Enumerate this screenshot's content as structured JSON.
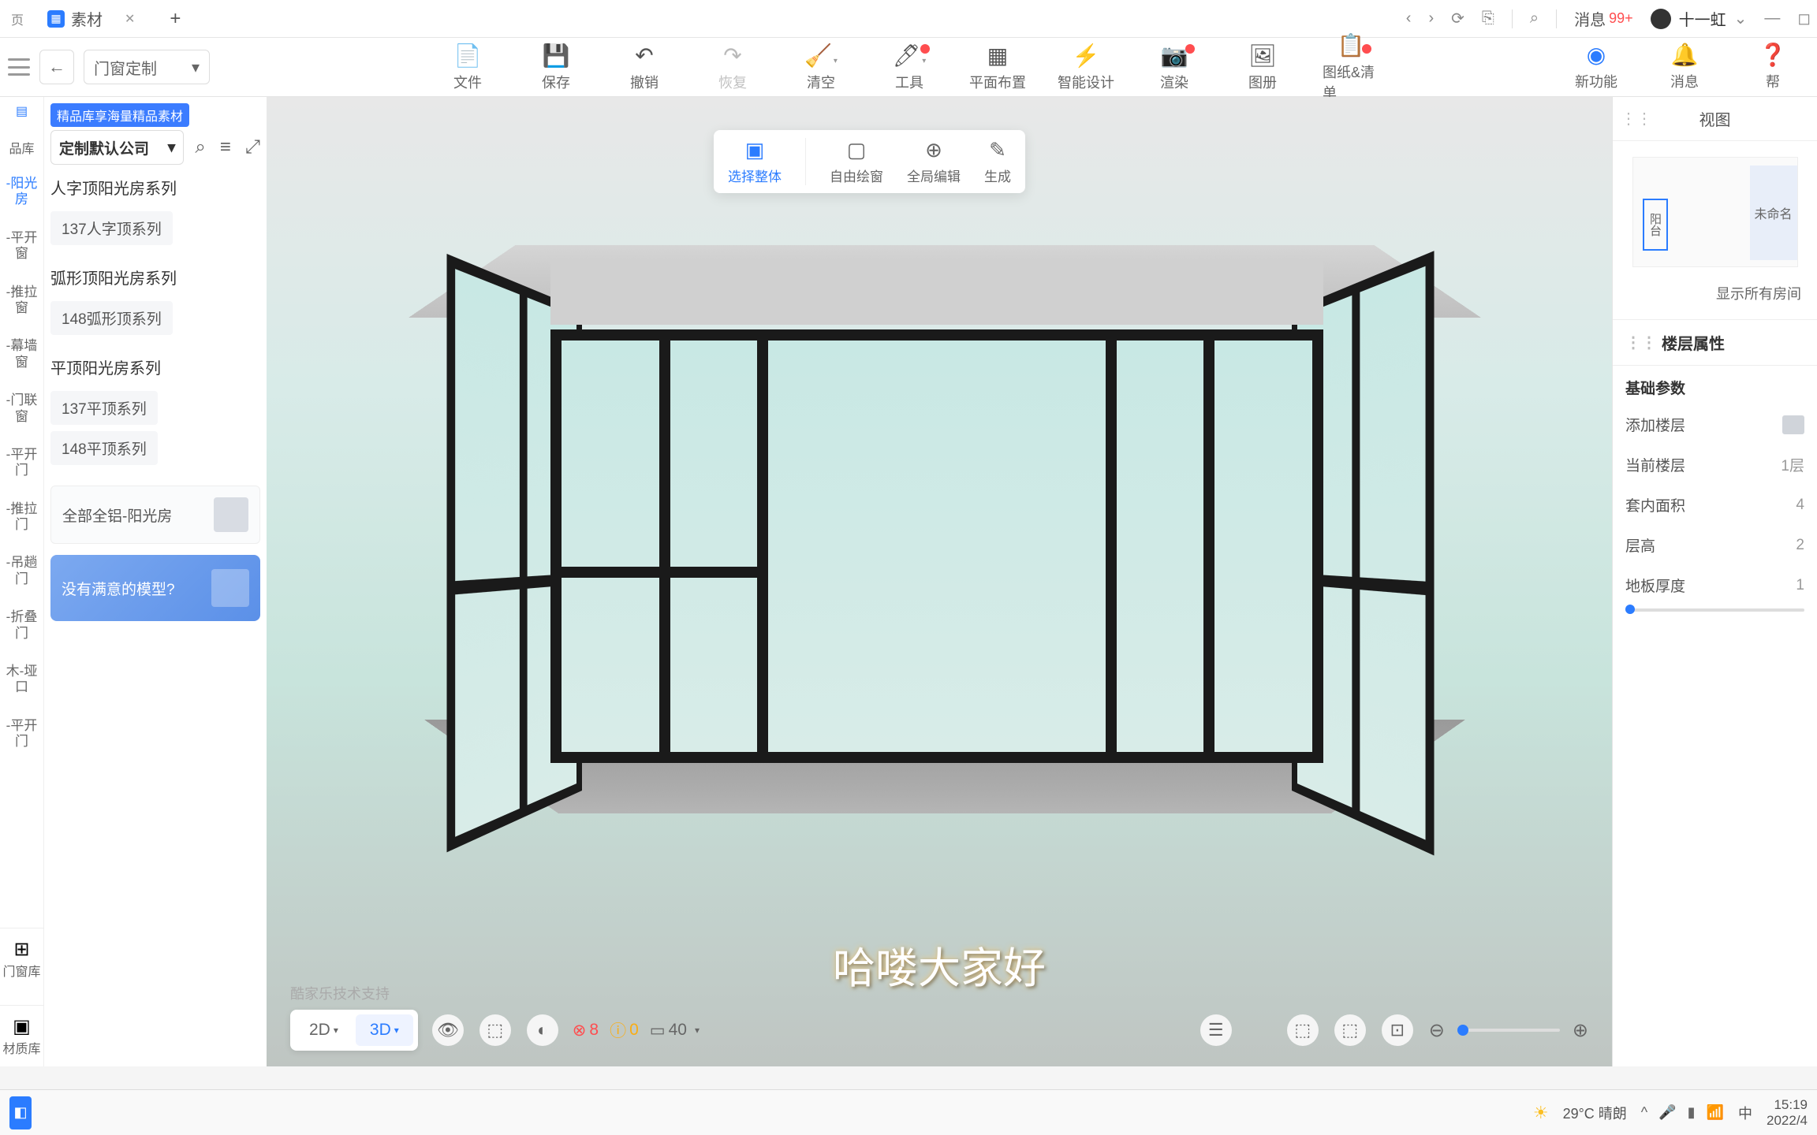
{
  "browser": {
    "tab_title": "素材",
    "messages_label": "消息",
    "messages_count": "99+",
    "username": "十一虹"
  },
  "app": {
    "mode": "门窗定制",
    "tools": [
      {
        "label": "文件",
        "icon": "📄"
      },
      {
        "label": "保存",
        "icon": "💾"
      },
      {
        "label": "撤销",
        "icon": "↶"
      },
      {
        "label": "恢复",
        "icon": "↷"
      },
      {
        "label": "清空",
        "icon": "🧹"
      },
      {
        "label": "工具",
        "icon": "🔧"
      },
      {
        "label": "平面布置",
        "icon": "▦"
      },
      {
        "label": "智能设计",
        "icon": "⚡"
      },
      {
        "label": "渲染",
        "icon": "📷"
      },
      {
        "label": "图册",
        "icon": "🖼"
      },
      {
        "label": "图纸&清单",
        "icon": "📋"
      }
    ],
    "right_tools": [
      {
        "label": "新功能",
        "icon": "◉"
      },
      {
        "label": "消息",
        "icon": "🔔"
      },
      {
        "label": "帮",
        "icon": "?"
      }
    ],
    "sub_tools": [
      {
        "label": "选择整体"
      },
      {
        "label": "自由绘窗"
      },
      {
        "label": "全局编辑"
      },
      {
        "label": "生成"
      }
    ]
  },
  "sidebar": {
    "promo": "精品库享海量精品素材",
    "search_label": "定制默认公司",
    "narrow": {
      "lib_label": "品库",
      "items": [
        "-阳光房",
        "-平开窗",
        "-推拉窗",
        "-幕墙窗",
        "-门联窗",
        "-平开门",
        "-推拉门",
        "-吊趟门",
        "-折叠门",
        "木-垭口",
        "-平开门"
      ],
      "bottom1": "门窗库",
      "bottom2": "材质库"
    },
    "categories": [
      {
        "title": "人字顶阳光房系列",
        "chips": [
          "137人字顶系列"
        ]
      },
      {
        "title": "弧形顶阳光房系列",
        "chips": [
          "148弧形顶系列"
        ]
      },
      {
        "title": "平顶阳光房系列",
        "chips": [
          "137平顶系列",
          "148平顶系列"
        ]
      }
    ],
    "product": "全部全铝-阳光房",
    "no_model": "没有满意的模型?"
  },
  "canvas": {
    "watermark": "酷家乐技术支持",
    "subtitle": "哈喽大家好",
    "view_2d": "2D",
    "view_3d": "3D",
    "status_red": "8",
    "status_yellow": "0",
    "status_walls": "40"
  },
  "right_panel": {
    "view_label": "视图",
    "balcony": "阳台",
    "room_unnamed": "未命名",
    "show_all": "显示所有房间",
    "section_title": "楼层属性",
    "group_title": "基础参数",
    "props": {
      "add_floor": "添加楼层",
      "current_floor_label": "当前楼层",
      "current_floor_value": "1层",
      "area_label": "套内面积",
      "area_value": "4",
      "height_label": "层高",
      "height_value": "2",
      "floor_thick_label": "地板厚度",
      "floor_thick_value": "1"
    }
  },
  "taskbar": {
    "weather": "29°C 晴朗",
    "ime": "中",
    "time": "15:19",
    "date": "2022/4"
  }
}
